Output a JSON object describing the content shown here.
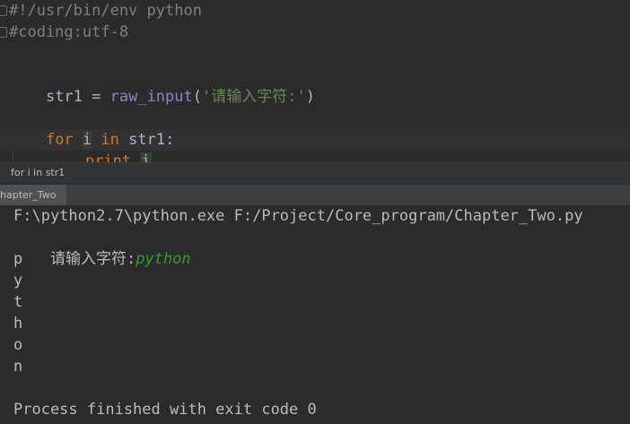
{
  "editor": {
    "lines": [
      {
        "id": "shebang",
        "text": "#!/usr/bin/env python"
      },
      {
        "id": "coding",
        "text": "#coding:utf-8"
      },
      {
        "id": "assign",
        "var": "str1",
        "op": " = ",
        "func": "raw_input",
        "open": "(",
        "arg": "'请输入字符:'",
        "close": ")"
      },
      {
        "id": "for",
        "kw_for": "for",
        "loop_var": "i",
        "kw_in": "in",
        "iter": "str1:"
      },
      {
        "id": "print",
        "kw_print": "print",
        "arg": "i"
      }
    ]
  },
  "breadcrumb": {
    "text": "for i in str1"
  },
  "run_tab": {
    "label": "hapter_Two"
  },
  "console": {
    "command": "F:\\python2.7\\python.exe F:/Project/Core_program/Chapter_Two.py",
    "prompt": "请输入字符:",
    "user_input": "python",
    "output_chars": [
      "p",
      "y",
      "t",
      "h",
      "o",
      "n"
    ],
    "exit_message": "Process finished with exit code 0"
  },
  "colors": {
    "background": "#2b2b2b",
    "keyword": "#cc7832",
    "string": "#6a8759",
    "builtin": "#8888c6",
    "comment": "#808080",
    "user_input": "#2f9d2f"
  }
}
